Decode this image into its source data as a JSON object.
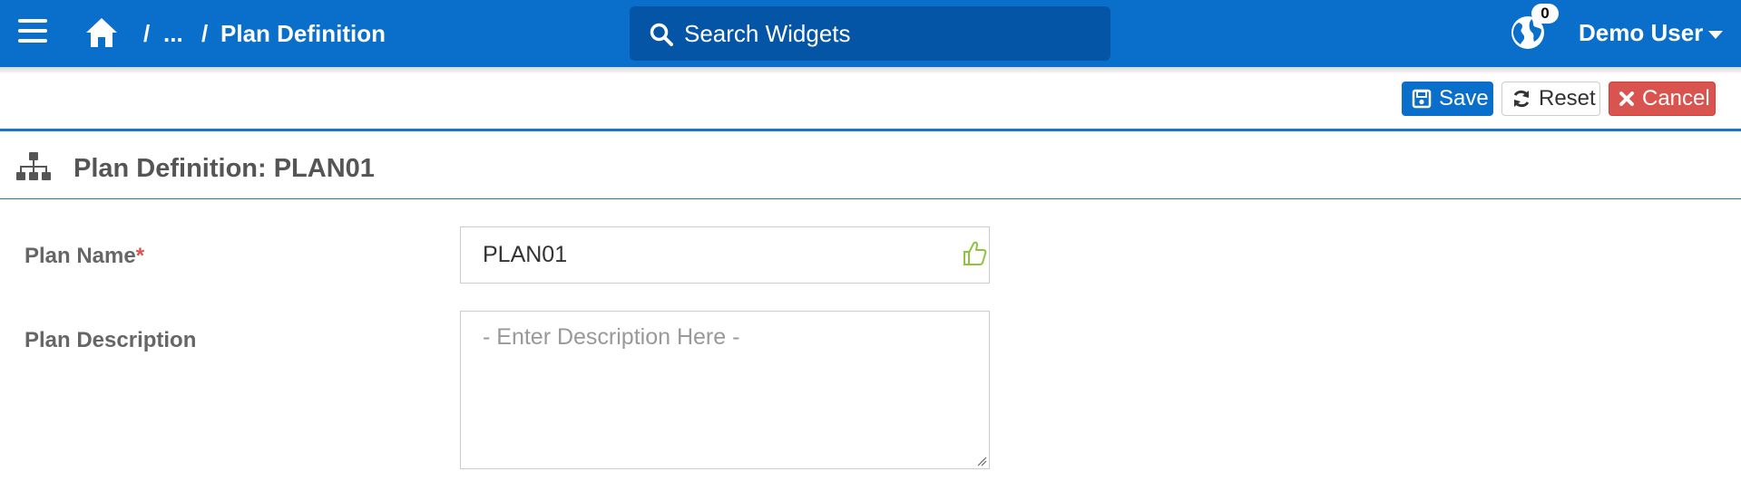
{
  "header": {
    "breadcrumb_sep1": "/",
    "breadcrumb_ellipsis": "...",
    "breadcrumb_sep2": "/",
    "breadcrumb_current": "Plan Definition",
    "search_placeholder": "Search Widgets",
    "notification_count": "0",
    "user_name": "Demo User"
  },
  "toolbar": {
    "save_label": "Save",
    "reset_label": "Reset",
    "cancel_label": "Cancel"
  },
  "panel": {
    "title": "Plan Definition: PLAN01"
  },
  "form": {
    "plan_name_label": "Plan Name",
    "required_marker": "*",
    "plan_name_value": "PLAN01",
    "plan_description_label": "Plan Description",
    "plan_description_placeholder": "- Enter Description Here -"
  },
  "colors": {
    "header_bg": "#0a6ecb",
    "search_bg": "#0455a6",
    "save_button": "#0a6ecb",
    "cancel_button": "#d9534f",
    "valid_icon": "#8cc43f"
  }
}
